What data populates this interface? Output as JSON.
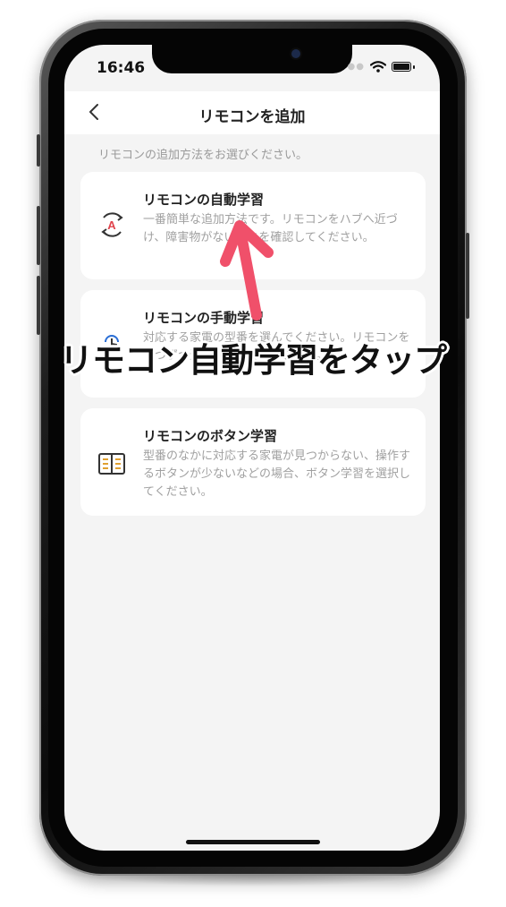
{
  "status_bar": {
    "time": "16:46"
  },
  "header": {
    "title": "リモコンを追加",
    "back_icon": "chevron-left-icon"
  },
  "hint": "リモコンの追加方法をお選びください。",
  "cards": [
    {
      "icon": "auto-learn-icon",
      "title": "リモコンの自動学習",
      "description": "一番簡単な追加方法です。リモコンをハブへ近づけ、障害物がないことを確認してください。"
    },
    {
      "icon": "touch-icon",
      "title": "リモコンの手動学習",
      "description": "対応する家電の型番を選んでください。リモコンを一つずつ追加することができます。"
    },
    {
      "icon": "book-icon",
      "title": "リモコンのボタン学習",
      "description": "型番のなかに対応する家電が見つからない、操作するボタンが少ないなどの場合、ボタン学習を選択してください。"
    }
  ],
  "overlay_caption": "リモコン自動学習をタップ",
  "colors": {
    "accent_red": "#e0434b",
    "arrow": "#f0506a",
    "screen_bg": "#f4f4f4",
    "card_bg": "#ffffff"
  }
}
